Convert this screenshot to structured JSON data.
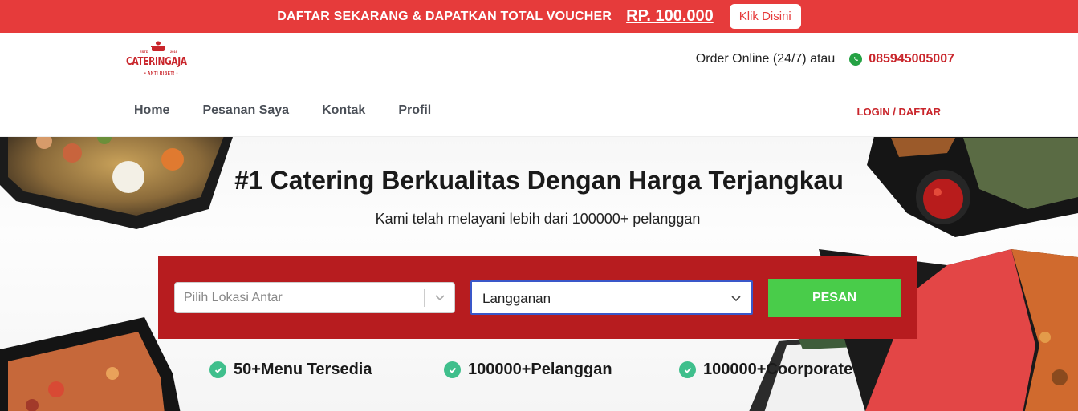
{
  "promo": {
    "text": "DAFTAR SEKARANG & DAPATKAN TOTAL VOUCHER",
    "amount": "RP. 100.000",
    "cta": "Klik Disini"
  },
  "brand": {
    "name": "CATERINGAJA",
    "est_left": "ESTD",
    "est_right": "2016",
    "tagline": "• ANTI RIBET! •"
  },
  "contact": {
    "label": "Order Online (24/7) atau",
    "phone": "085945005007",
    "icon": "whatsapp-icon"
  },
  "nav": {
    "items": [
      {
        "label": "Home"
      },
      {
        "label": "Pesanan Saya"
      },
      {
        "label": "Kontak"
      },
      {
        "label": "Profil"
      }
    ],
    "login": "LOGIN / DAFTAR"
  },
  "hero": {
    "title": "#1 Catering Berkualitas Dengan Harga Terjangkau",
    "subtitle": "Kami telah melayani lebih dari 100000+ pelanggan"
  },
  "order_form": {
    "location_placeholder": "Pilih Lokasi Antar",
    "type_value": "Langganan",
    "submit": "PESAN"
  },
  "features": [
    {
      "label": "50+Menu Tersedia"
    },
    {
      "label": "100000+Pelanggan"
    },
    {
      "label": "100000+Coorporate"
    }
  ],
  "colors": {
    "brand_red": "#c9252b",
    "promo_red": "#e63b3b",
    "form_red": "#b71c1f",
    "submit_green": "#49cc4a",
    "check_green": "#3fbf8c"
  }
}
